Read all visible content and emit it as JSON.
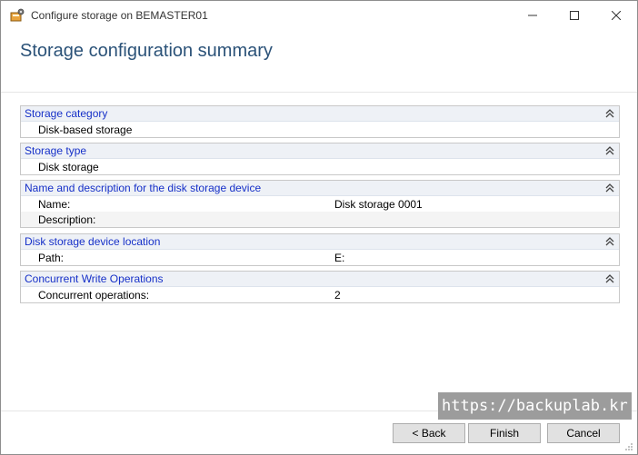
{
  "window": {
    "title": "Configure storage on BEMASTER01"
  },
  "page": {
    "title": "Storage configuration summary"
  },
  "groups": [
    {
      "title": "Storage category",
      "rows": [
        {
          "label": "Disk-based storage",
          "value": ""
        }
      ]
    },
    {
      "title": "Storage type",
      "rows": [
        {
          "label": "Disk storage",
          "value": ""
        }
      ]
    },
    {
      "title": "Name and description for the disk storage device",
      "rows": [
        {
          "label": "Name:",
          "value": "Disk storage 0001"
        },
        {
          "label": "Description:",
          "value": ""
        }
      ]
    },
    {
      "title": "Disk storage device location",
      "rows": [
        {
          "label": "Path:",
          "value": "E:"
        }
      ]
    },
    {
      "title": "Concurrent Write Operations",
      "rows": [
        {
          "label": "Concurrent operations:",
          "value": "2"
        }
      ]
    }
  ],
  "buttons": {
    "back": "< Back",
    "finish": "Finish",
    "cancel": "Cancel"
  },
  "watermark": "https://backuplab.kr",
  "colors": {
    "title_blue": "#2b5278",
    "group_title_blue": "#1630c8",
    "group_header_bg": "#eef1f6"
  },
  "icons": {
    "app": "storage-config-icon",
    "collapse": "double-chevron-up-icon"
  }
}
